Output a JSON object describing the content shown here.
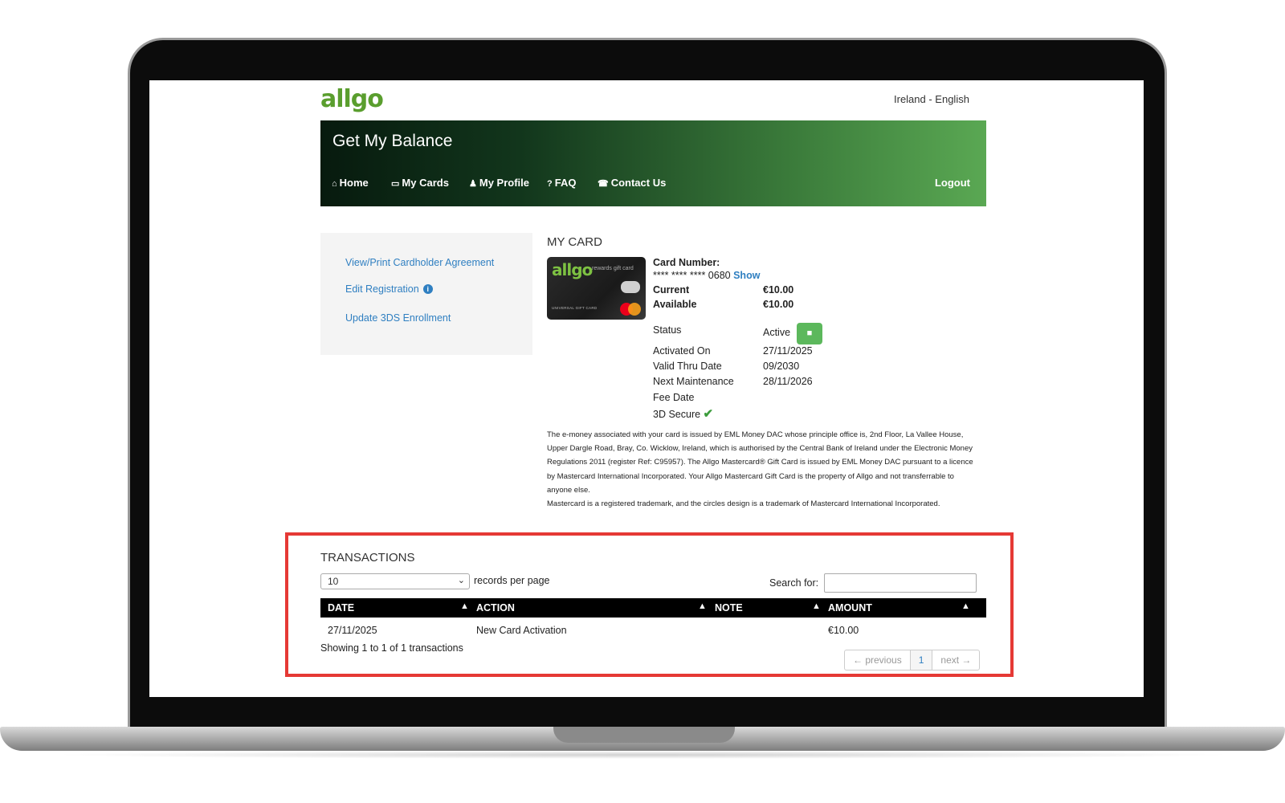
{
  "header": {
    "logo": "allgo",
    "locale": "Ireland - English"
  },
  "banner": {
    "title": "Get My Balance",
    "nav": [
      {
        "icon": "home-icon",
        "glyph": "⌂",
        "label": "Home"
      },
      {
        "icon": "card-icon",
        "glyph": "▭",
        "label": "My Cards"
      },
      {
        "icon": "user-icon",
        "glyph": "♟",
        "label": "My Profile"
      },
      {
        "icon": "question-icon",
        "glyph": "?",
        "label": "FAQ"
      },
      {
        "icon": "phone-icon",
        "glyph": "☎",
        "label": "Contact Us"
      }
    ],
    "logout": "Logout"
  },
  "sidebar": {
    "links": [
      "View/Print Cardholder Agreement",
      "Edit Registration",
      "Update 3DS Enrollment"
    ]
  },
  "my_card": {
    "title": "MY CARD",
    "card_image": {
      "brand": "allgo",
      "subtitle": "rewards gift card",
      "small_text": "UNIVERSAL GIFT CARD"
    },
    "card_number_label": "Card Number:",
    "card_number": "**** **** **** 0680",
    "show_label": "Show",
    "current_label": "Current",
    "current_value": "€10.00",
    "available_label": "Available",
    "available_value": "€10.00",
    "status_label": "Status",
    "status_value": "Active",
    "activated_label": "Activated On",
    "activated_value": "27/11/2025",
    "valid_thru_label": "Valid Thru Date",
    "valid_thru_value": "09/2030",
    "next_maint_label": "Next Maintenance",
    "next_maint_value": "28/11/2026",
    "fee_date_label": "Fee Date",
    "secure_label": "3D Secure",
    "legal_1": "The e-money associated with your card is issued by EML Money DAC whose principle office is, 2nd Floor, La Vallee House, Upper Dargle Road, Bray, Co. Wicklow, Ireland, which is authorised by the Central Bank of Ireland under the Electronic Money Regulations 2011 (register Ref: C95957). The Allgo Mastercard® Gift Card is issued by EML Money DAC pursuant to a licence by Mastercard International Incorporated. Your Allgo Mastercard Gift Card is the property of Allgo and not transferrable to anyone else.",
    "legal_2": "Mastercard is a registered trademark, and the circles design is a trademark of Mastercard International Incorporated."
  },
  "transactions": {
    "title": "TRANSACTIONS",
    "per_page_value": "10",
    "per_page_label": "records per page",
    "search_label": "Search for:",
    "search_value": "",
    "columns": [
      "DATE",
      "ACTION",
      "NOTE",
      "AMOUNT"
    ],
    "rows": [
      {
        "date": "27/11/2025",
        "action": "New Card Activation",
        "note": "",
        "amount": "€10.00"
      }
    ],
    "showing": "Showing 1 to 1 of 1 transactions",
    "pagination": {
      "previous": "← previous",
      "page": "1",
      "next": "next →"
    }
  },
  "colors": {
    "brand_green": "#5a9e2e",
    "link_blue": "#2f7fc1",
    "highlight_red": "#e53935",
    "status_green": "#5cb85c"
  }
}
